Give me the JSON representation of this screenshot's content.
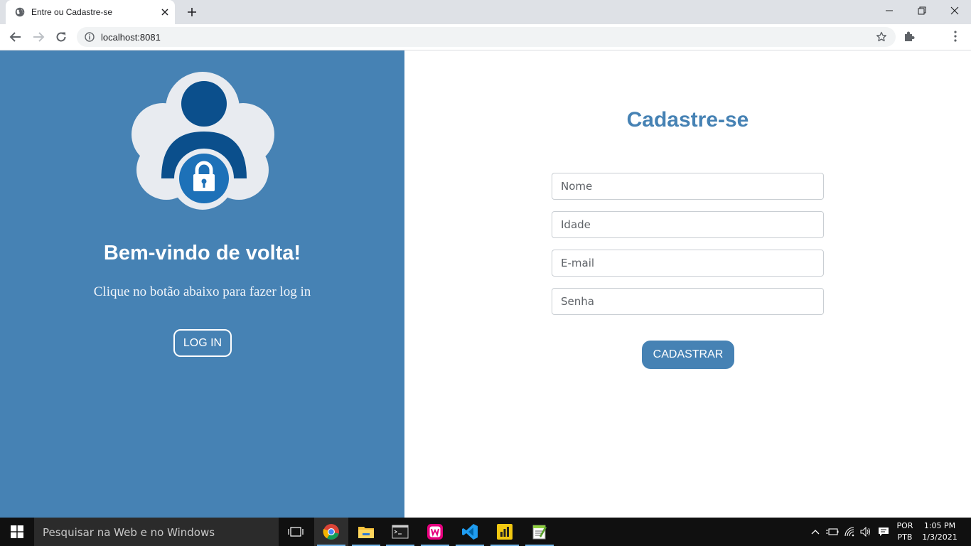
{
  "browser": {
    "tab_title": "Entre ou Cadastre-se",
    "url": "localhost:8081"
  },
  "left_panel": {
    "heading": "Bem-vindo de volta!",
    "subtitle": "Clique no botão abaixo para fazer log in",
    "login_button": "LOG IN"
  },
  "register_form": {
    "title": "Cadastre-se",
    "fields": [
      {
        "placeholder": "Nome",
        "value": ""
      },
      {
        "placeholder": "Idade",
        "value": ""
      },
      {
        "placeholder": "E-mail",
        "value": ""
      },
      {
        "placeholder": "Senha",
        "value": ""
      }
    ],
    "submit_label": "CADASTRAR"
  },
  "taskbar": {
    "search_placeholder": "Pesquisar na Web e no Windows",
    "apps": [
      "chrome-icon",
      "file-explorer-icon",
      "terminal-icon",
      "wampserver-icon",
      "vscode-icon",
      "power-bi-icon",
      "notepad-plus-icon"
    ],
    "language": "POR",
    "keyboard": "PTB",
    "time": "1:05 PM",
    "date": "1/3/2021"
  },
  "colors": {
    "accent": "#4682b4",
    "avatar_dark": "#0b4f8c",
    "cloud": "#e8ebf0"
  }
}
